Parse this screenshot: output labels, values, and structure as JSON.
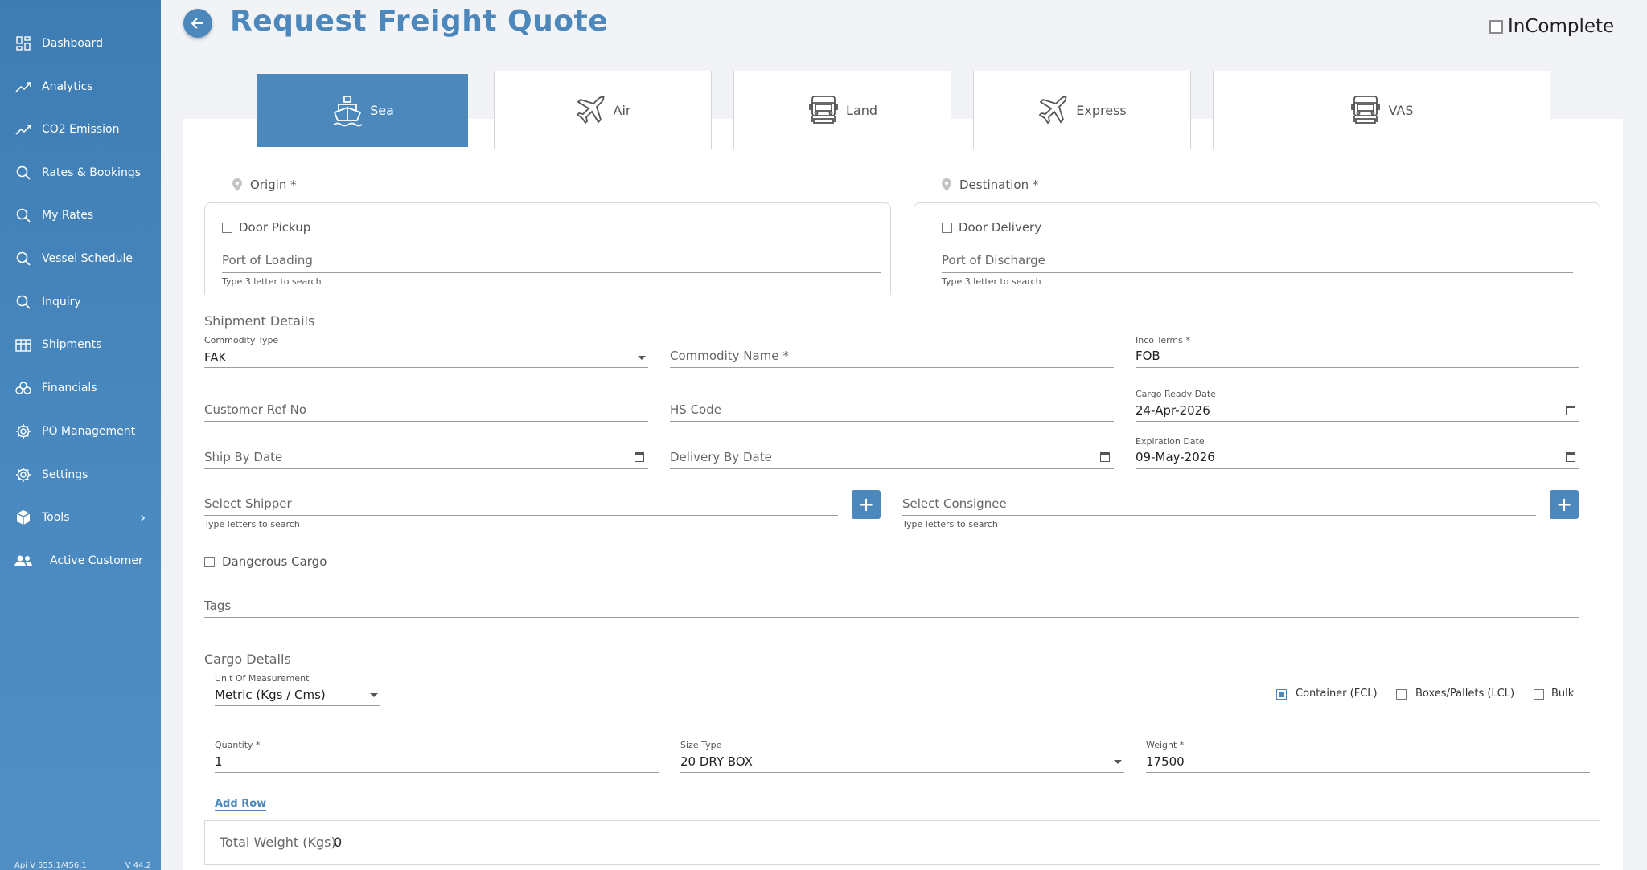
{
  "sidebar": {
    "items": [
      {
        "label": "Dashboard",
        "icon": "dashboard-icon"
      },
      {
        "label": "Analytics",
        "icon": "trend-icon"
      },
      {
        "label": "CO2 Emission",
        "icon": "trend-icon"
      },
      {
        "label": "Rates & Bookings",
        "icon": "search-icon"
      },
      {
        "label": "My Rates",
        "icon": "search-icon"
      },
      {
        "label": "Vessel Schedule",
        "icon": "search-icon"
      },
      {
        "label": "Inquiry",
        "icon": "search-icon"
      },
      {
        "label": "Shipments",
        "icon": "shipments-icon"
      },
      {
        "label": "Financials",
        "icon": "financials-icon"
      },
      {
        "label": "PO Management",
        "icon": "gear-icon"
      },
      {
        "label": "Settings",
        "icon": "gear-icon"
      },
      {
        "label": "Tools",
        "icon": "box-icon"
      },
      {
        "label": "Active Customer",
        "icon": "users-icon"
      }
    ],
    "footer_api": "Api V 555.1/456.1",
    "footer_version": "V 44.2"
  },
  "header": {
    "title": "Request Freight Quote",
    "incomplete_label": "InComplete"
  },
  "modes": [
    {
      "label": "Sea",
      "icon": "ship-icon",
      "active": true
    },
    {
      "label": "Air",
      "icon": "plane-icon",
      "active": false
    },
    {
      "label": "Land",
      "icon": "truck-icon",
      "active": false
    },
    {
      "label": "Express",
      "icon": "plane-icon",
      "active": false
    },
    {
      "label": "VAS",
      "icon": "truck-icon",
      "active": false
    }
  ],
  "origin": {
    "label": "Origin *",
    "door_label": "Door Pickup",
    "port_placeholder": "Port of Loading",
    "hint": "Type 3 letter to search"
  },
  "destination": {
    "label": "Destination *",
    "door_label": "Door Delivery",
    "port_placeholder": "Port of Discharge",
    "hint": "Type 3 letter to search"
  },
  "shipment": {
    "section_title": "Shipment Details",
    "commodity_type_label": "Commodity Type",
    "commodity_type_value": "FAK",
    "commodity_name_placeholder": "Commodity Name *",
    "inco_label": "Inco Terms *",
    "inco_value": "FOB",
    "customer_ref_placeholder": "Customer Ref No",
    "hs_code_placeholder": "HS Code",
    "cargo_ready_label": "Cargo Ready Date",
    "cargo_ready_value": "24-Apr-2026",
    "ship_by_placeholder": "Ship By Date",
    "delivery_by_placeholder": "Delivery By Date",
    "expiration_label": "Expiration Date",
    "expiration_value": "09-May-2026",
    "shipper_placeholder": "Select Shipper",
    "shipper_hint": "Type letters to search",
    "consignee_placeholder": "Select Consignee",
    "consignee_hint": "Type letters to search",
    "dangerous_label": "Dangerous Cargo",
    "tags_placeholder": "Tags"
  },
  "cargo": {
    "section_title": "Cargo Details",
    "uom_label": "Unit Of Measurement",
    "uom_value": "Metric (Kgs / Cms)",
    "load_types": [
      {
        "label": "Container (FCL)",
        "checked": true
      },
      {
        "label": "Boxes/Pallets (LCL)",
        "checked": false
      },
      {
        "label": "Bulk",
        "checked": false
      }
    ],
    "quantity_label": "Quantity *",
    "quantity_value": "1",
    "size_type_label": "Size Type",
    "size_type_value": "20 DRY BOX",
    "weight_label": "Weight *",
    "weight_value": "17500",
    "add_row_label": "Add Row",
    "total_weight_label": "Total Weight (Kgs)",
    "total_weight_value": "0"
  },
  "colors": {
    "brand": "#4d88bd",
    "sidebar_top": "#3e7db4",
    "sidebar_bottom": "#4f8fc4"
  }
}
